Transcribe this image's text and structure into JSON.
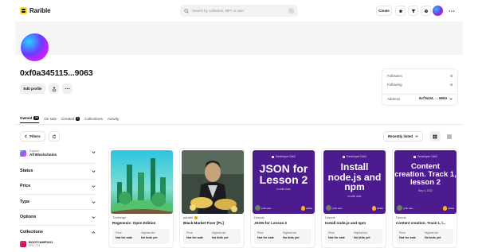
{
  "header": {
    "brand": "Rarible",
    "search_placeholder": "Search by collection, NFT or user",
    "search_shortcut": "/",
    "create_label": "Create"
  },
  "profile": {
    "address": "0xf0a345115...9063",
    "edit_label": "Edit profile",
    "stats": {
      "followers_label": "Followers",
      "followers_value": "0",
      "following_label": "Following",
      "following_value": "0",
      "address_label": "Address",
      "address_value": "0xf0a34...9063"
    }
  },
  "tabs": [
    {
      "label": "Owned",
      "count": "20"
    },
    {
      "label": "On sale"
    },
    {
      "label": "Created",
      "count": "1"
    },
    {
      "label": "Collections"
    },
    {
      "label": "Activity"
    }
  ],
  "toolbar": {
    "filters_label": "Filters",
    "sort_label": "Recently listed"
  },
  "sidebar": {
    "chain_small": "Explore",
    "chain_big": "All Blockchains",
    "sections": [
      "Status",
      "Price",
      "Type",
      "Options",
      "Collections"
    ],
    "collection_name": "BOOTCAMP2021",
    "collection_sub": "ERC-721"
  },
  "cards": [
    {
      "collection": "TheMerge",
      "name": "Regenesis: Open Edition",
      "price_label": "Price",
      "price": "Not for sale",
      "bid_label": "Highest bid",
      "bid": "No bids yet"
    },
    {
      "collection": "parallel",
      "name": "Black Market Fixer [PL]",
      "price_label": "Price",
      "price": "Not for sale",
      "bid_label": "Highest bid",
      "bid": "No bids yet"
    },
    {
      "collection": "Dework",
      "name": "JSON for Lesson 2",
      "price_label": "Price",
      "price": "Not for sale",
      "bid_label": "Highest bid",
      "bid": "No bids yet",
      "art": {
        "header": "Developer DAO",
        "title": "JSON for Lesson 2",
        "sub": "Invalid date",
        "user1": "john.eas...",
        "user2": "pinkie"
      }
    },
    {
      "collection": "Dework",
      "name": "Install node.js and npm",
      "price_label": "Price",
      "price": "Not for sale",
      "bid_label": "Highest bid",
      "bid": "No bids yet",
      "art": {
        "header": "Developer DAO",
        "title": "Install node.js and npm",
        "sub": "Invalid date",
        "user1": "john.eas...",
        "user2": "pinkie"
      }
    },
    {
      "collection": "Dework",
      "name": "Content creation. Track 1, l...",
      "price_label": "Price",
      "price": "Not for sale",
      "bid_label": "Highest bid",
      "bid": "No bids yet",
      "art": {
        "header": "Developer DAO",
        "title": "Content creation. Track 1, lesson 2",
        "sub": "Sep 4, 2022",
        "user1": "john.eas...",
        "user2": "pinkie"
      }
    }
  ],
  "colors": {
    "brand": "#ffe400",
    "nft_purple": "#4b1b8f"
  },
  "icons": [
    "search-icon",
    "star-icon",
    "filter-icon",
    "grid-icon",
    "more-icon",
    "share-icon",
    "refresh-icon",
    "chevron-down-icon"
  ]
}
